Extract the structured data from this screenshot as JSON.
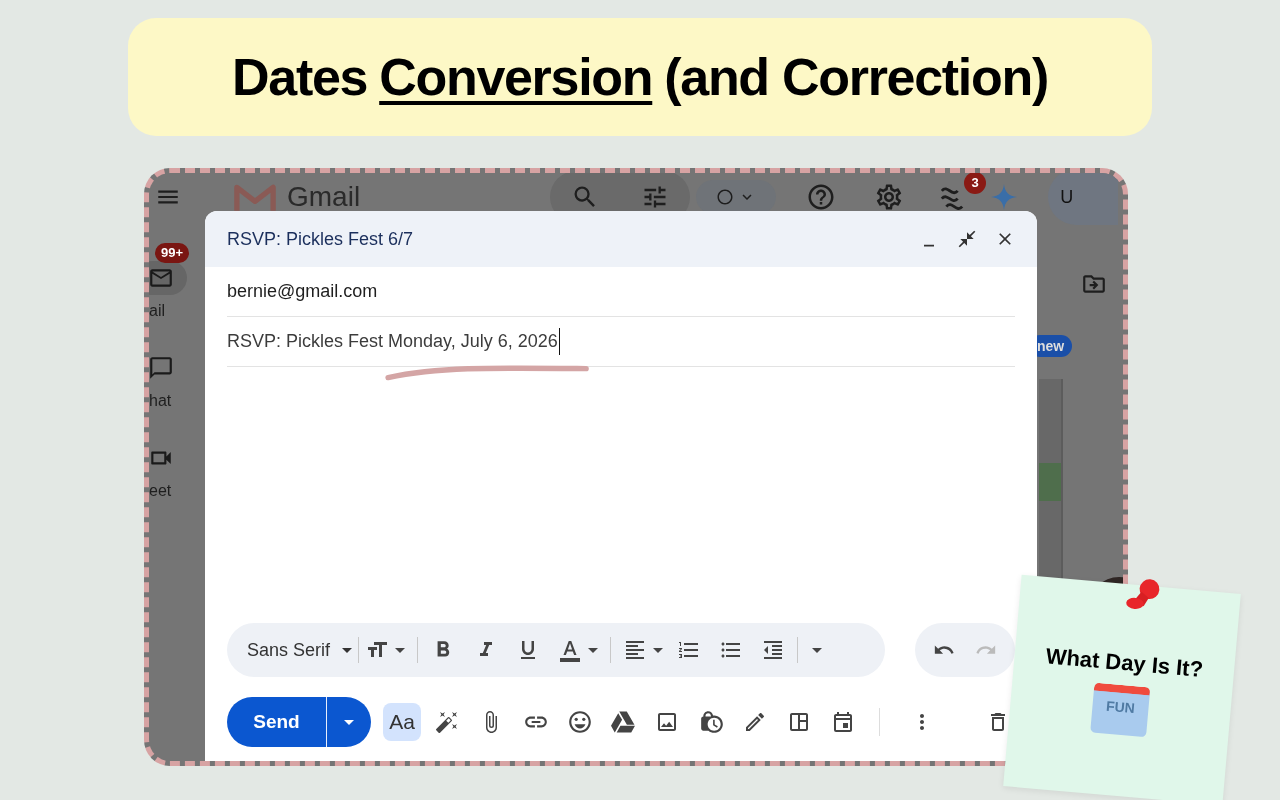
{
  "banner": {
    "title_parts": [
      {
        "text": "Dates",
        "underlined": false
      },
      {
        "text": "Conversion",
        "underlined": true
      },
      {
        "text": "(and Correction)",
        "underlined": false
      }
    ]
  },
  "gmail": {
    "app_name": "Gmail",
    "apps_badge": "3",
    "avatar_text": "U",
    "chip": "new",
    "rail": [
      {
        "label": "ail",
        "badge": "99+",
        "selected": true
      },
      {
        "label": "hat",
        "selected": false
      },
      {
        "label": "eet",
        "selected": false
      }
    ]
  },
  "compose": {
    "title": "RSVP: Pickles Fest 6/7",
    "to": "bernie@gmail.com",
    "subject": "RSVP: Pickles Fest Monday, July 6, 2026",
    "font": "Sans Serif",
    "send": "Send",
    "text_style_button": "Aa"
  },
  "note": {
    "text": "What Day Is It?",
    "calendar_text": "FUN"
  }
}
